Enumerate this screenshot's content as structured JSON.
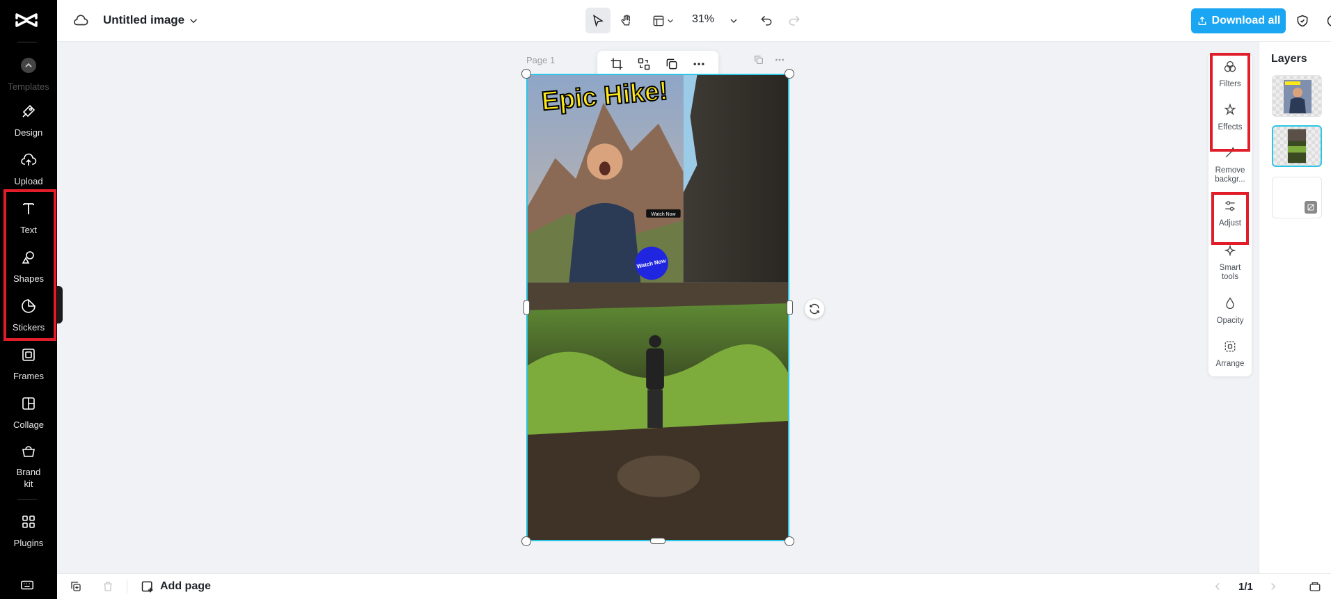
{
  "app": {
    "title": "Untitled image"
  },
  "sidebar": {
    "items": [
      {
        "label": "Templates"
      },
      {
        "label": "Design"
      },
      {
        "label": "Upload"
      },
      {
        "label": "Text"
      },
      {
        "label": "Shapes"
      },
      {
        "label": "Stickers"
      },
      {
        "label": "Frames"
      },
      {
        "label": "Collage"
      },
      {
        "label": "Brand kit"
      },
      {
        "label": "Plugins"
      }
    ]
  },
  "topbar": {
    "zoom": "31%",
    "download_label": "Download all"
  },
  "canvas": {
    "page_label": "Page 1",
    "headline": "Epic Hike!",
    "watch_now_tag": "Watch Now",
    "watch_now_circle": "Watch Now"
  },
  "tools": {
    "items": [
      {
        "label": "Filters"
      },
      {
        "label": "Effects"
      },
      {
        "label": "Remove backgr..."
      },
      {
        "label": "Adjust"
      },
      {
        "label": "Smart tools"
      },
      {
        "label": "Opacity"
      },
      {
        "label": "Arrange"
      }
    ]
  },
  "layers": {
    "title": "Layers"
  },
  "bottombar": {
    "add_page_label": "Add page",
    "page_count": "1/1"
  },
  "colors": {
    "accent": "#1aa6f2",
    "selection": "#2ec6e6",
    "highlight": "#e11d2a",
    "sidebar_bg": "#000000"
  }
}
